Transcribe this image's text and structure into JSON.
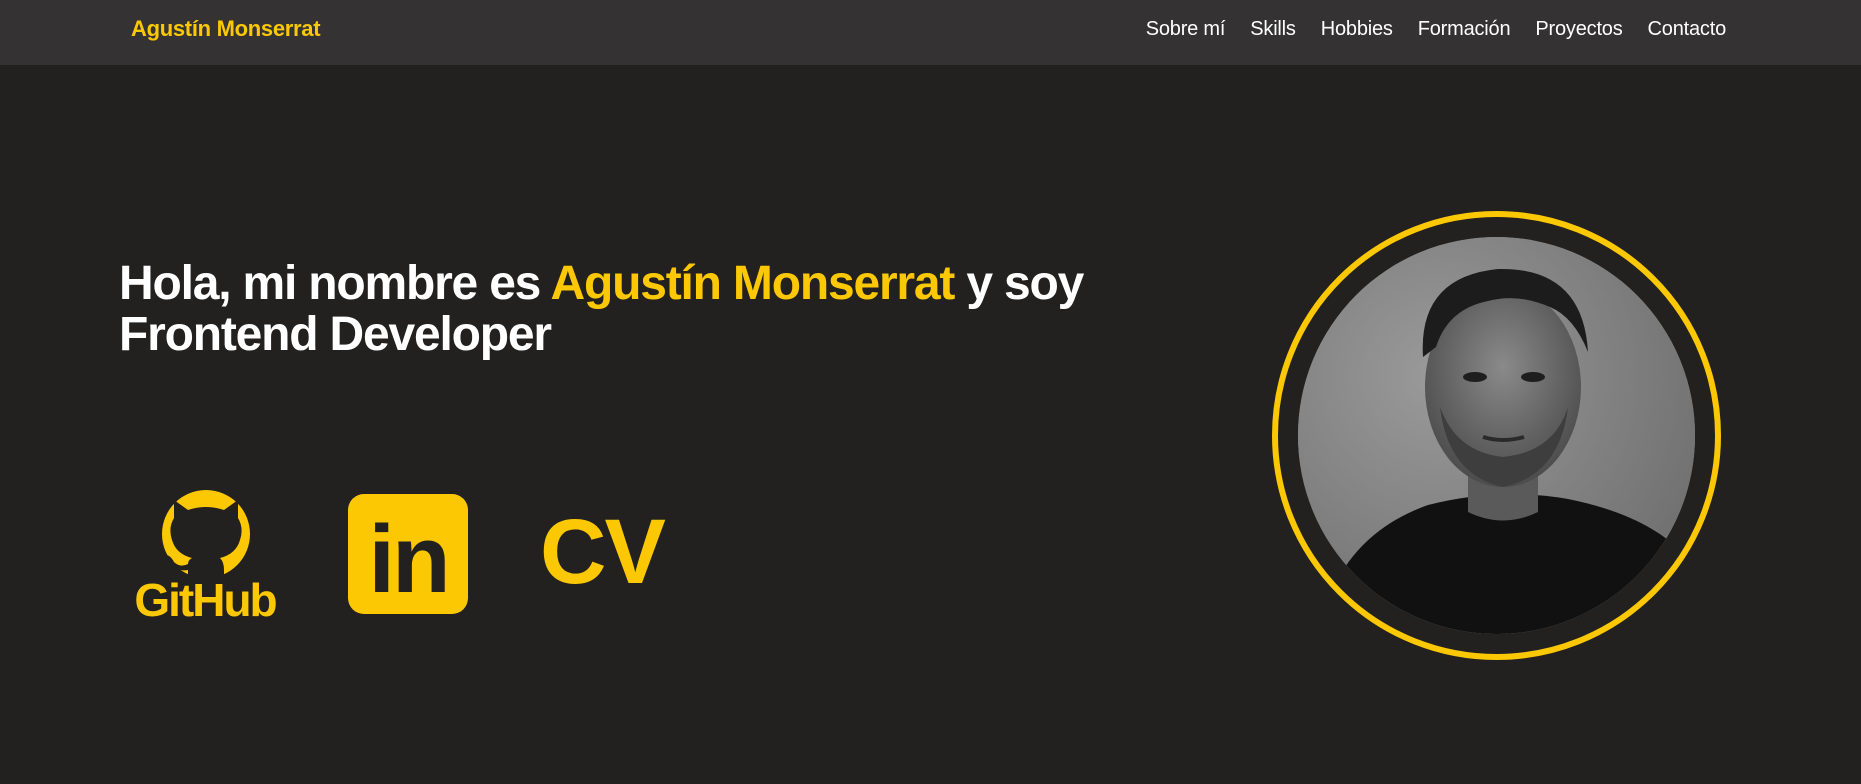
{
  "navbar": {
    "brand": "Agustín Monserrat",
    "links": [
      "Sobre mí",
      "Skills",
      "Hobbies",
      "Formación",
      "Proyectos",
      "Contacto"
    ]
  },
  "hero": {
    "headline_prefix": "Hola, mi nombre es ",
    "headline_name": "Agustín Monserrat",
    "headline_suffix": " y soy Frontend Developer"
  },
  "social": {
    "github_label": "GitHub",
    "linkedin_label": "in",
    "cv_label": "CV"
  },
  "colors": {
    "accent": "#fbc803",
    "background": "#222120",
    "navbar": "#343233",
    "text": "#ffffff"
  },
  "icons": [
    "github-icon",
    "linkedin-icon",
    "cv-icon"
  ]
}
